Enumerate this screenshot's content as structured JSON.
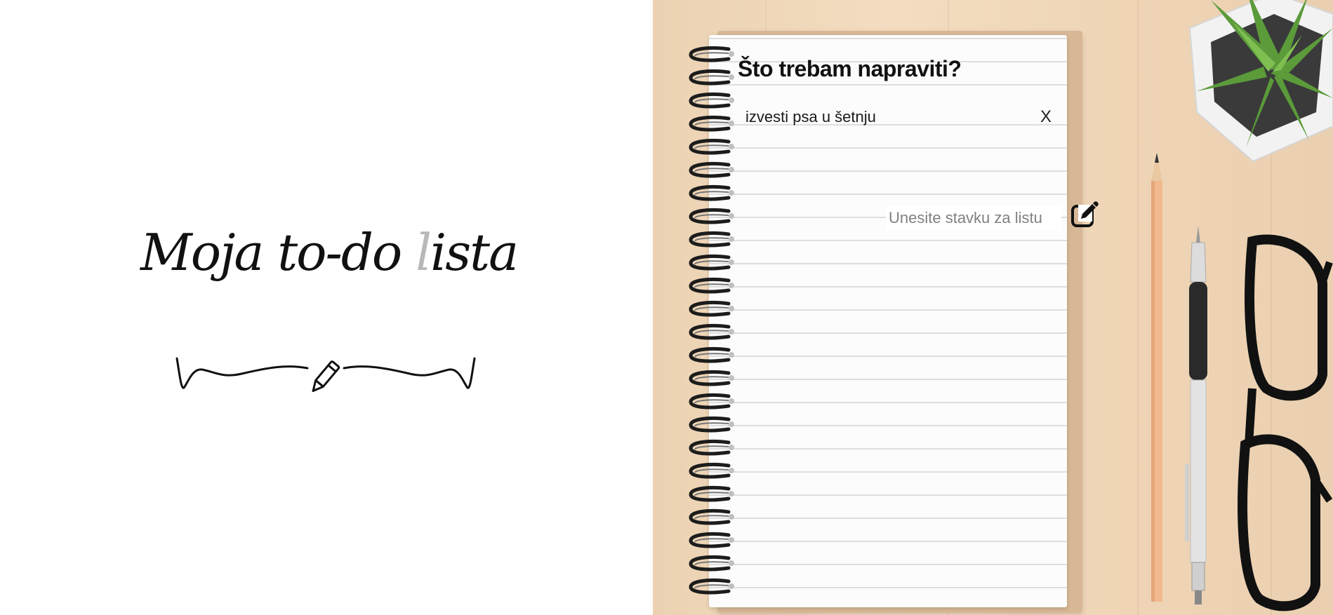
{
  "branding": {
    "title_main": "Moja to-do ",
    "title_accent": "l",
    "title_end": "ista"
  },
  "list": {
    "heading": "Što trebam napraviti?",
    "items": [
      {
        "text": "izvesti psa u šetnju",
        "delete_label": "X"
      }
    ]
  },
  "new_item": {
    "placeholder": "Unesite stavku za listu",
    "value": ""
  },
  "icons": {
    "flourish": "pencil-flourish-icon",
    "add": "edit-square-icon"
  },
  "colors": {
    "background_left": "#ffffff",
    "desk": "#f0d8bb",
    "text": "#111111",
    "placeholder": "#808080"
  }
}
